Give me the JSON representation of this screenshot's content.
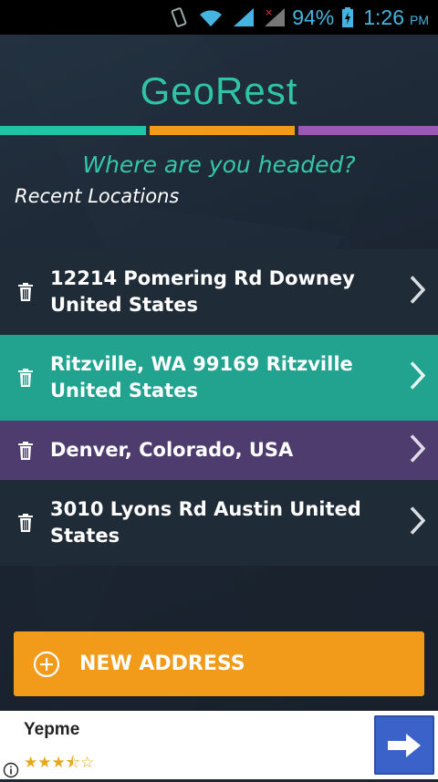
{
  "status_bar": {
    "battery_percent": "94%",
    "time": "1:26",
    "ampm": "PM"
  },
  "app": {
    "logo_text": "GeoRest",
    "accent_colors": [
      "#1ec4a4",
      "#f29a1a",
      "#9b59b6"
    ]
  },
  "main": {
    "heading": "Where are you headed?",
    "recent_label": "Recent Locations",
    "locations": [
      {
        "label": "12214 Pomering Rd Downey United States",
        "color": "#1f2b37"
      },
      {
        "label": "Ritzville, WA 99169 Ritzville United States",
        "color": "#22a38f"
      },
      {
        "label": "Denver, Colorado, USA",
        "color": "#4e3c6e"
      },
      {
        "label": "3010 Lyons Rd Austin United States",
        "color": "#1f2b37"
      }
    ],
    "new_address_label": "NEW ADDRESS"
  },
  "ad": {
    "app_name": "Yepme",
    "rating": 3.5,
    "rating_stars": "★★★⯪☆"
  }
}
